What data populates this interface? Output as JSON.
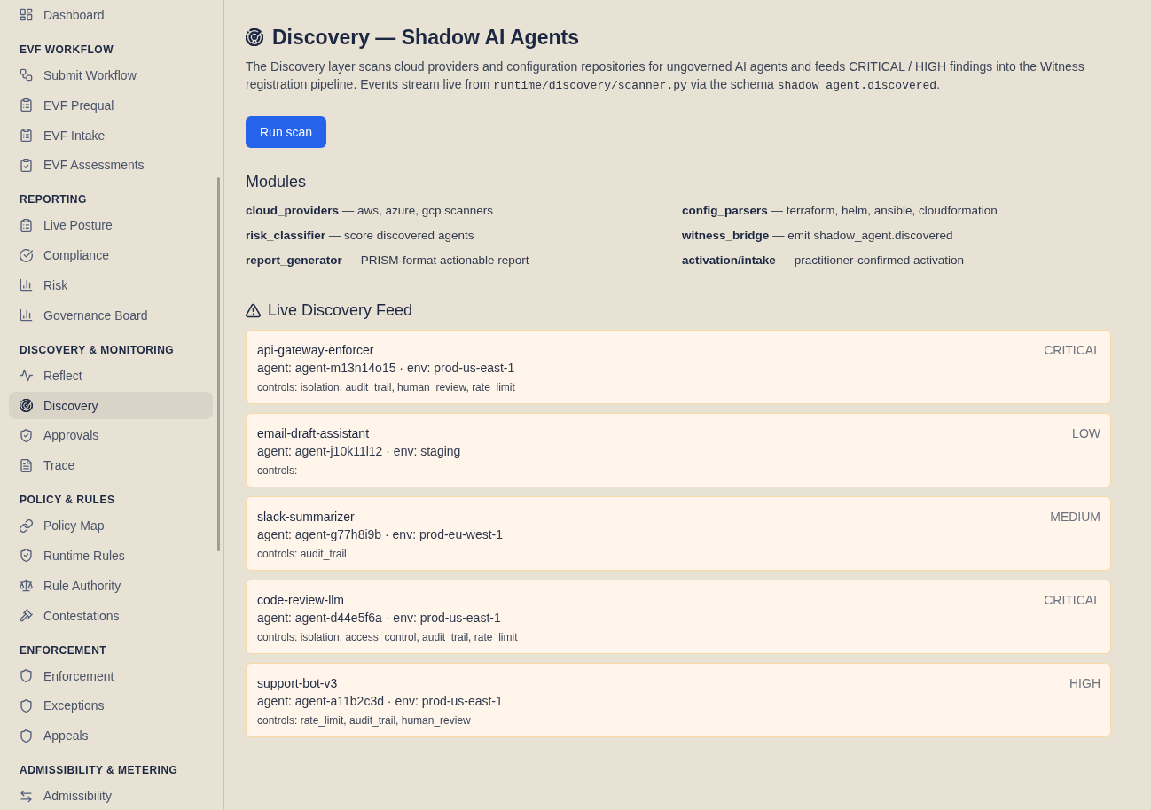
{
  "sidebar": {
    "sections": [
      {
        "items": [
          {
            "label": "Dashboard",
            "selected": false
          }
        ]
      },
      {
        "heading": "EVF WORKFLOW",
        "items": [
          {
            "label": "Submit Workflow",
            "selected": false
          },
          {
            "label": "EVF Prequal",
            "selected": false
          },
          {
            "label": "EVF Intake",
            "selected": false
          },
          {
            "label": "EVF Assessments",
            "selected": false
          }
        ]
      },
      {
        "heading": "REPORTING",
        "items": [
          {
            "label": "Live Posture",
            "selected": false
          },
          {
            "label": "Compliance",
            "selected": false
          },
          {
            "label": "Risk",
            "selected": false
          },
          {
            "label": "Governance Board",
            "selected": false
          }
        ]
      },
      {
        "heading": "DISCOVERY & MONITORING",
        "items": [
          {
            "label": "Reflect",
            "selected": false
          },
          {
            "label": "Discovery",
            "selected": true
          },
          {
            "label": "Approvals",
            "selected": false
          },
          {
            "label": "Trace",
            "selected": false
          }
        ]
      },
      {
        "heading": "POLICY & RULES",
        "items": [
          {
            "label": "Policy Map",
            "selected": false
          },
          {
            "label": "Runtime Rules",
            "selected": false
          },
          {
            "label": "Rule Authority",
            "selected": false
          },
          {
            "label": "Contestations",
            "selected": false
          }
        ]
      },
      {
        "heading": "ENFORCEMENT",
        "items": [
          {
            "label": "Enforcement",
            "selected": false
          },
          {
            "label": "Exceptions",
            "selected": false
          },
          {
            "label": "Appeals",
            "selected": false
          }
        ]
      },
      {
        "heading": "ADMISSIBILITY & METERING",
        "items": [
          {
            "label": "Admissibility",
            "selected": false
          }
        ]
      }
    ]
  },
  "page": {
    "title": "Discovery — Shadow AI Agents",
    "description": [
      {
        "kind": "text",
        "text": "The Discovery layer scans cloud providers and configuration repositories for ungoverned AI agents and feeds CRITICAL / HIGH findings into the Witness registration pipeline. Events stream live from "
      },
      {
        "kind": "code",
        "text": "runtime/discovery/scanner.py"
      },
      {
        "kind": "text",
        "text": " via the schema "
      },
      {
        "kind": "code",
        "text": "shadow_agent.discovered"
      },
      {
        "kind": "text",
        "text": "."
      }
    ],
    "run_button": "Run scan"
  },
  "modules": {
    "heading": "Modules",
    "items": [
      "**cloud_providers** — aws, azure, gcp scanners",
      "**config_parsers** — terraform, helm, ansible, cloudformation",
      "**risk_classifier** — score discovered agents",
      "**witness_bridge** — emit shadow_agent.discovered",
      "**report_generator** — PRISM-format actionable report",
      "**activation/intake** — practitioner-confirmed activation"
    ]
  },
  "feed": {
    "heading": "Live Discovery Feed",
    "findings": [
      {
        "name": "api-gateway-enforcer",
        "details": "agent: agent-m13n14o15 · env: prod-us-east-1",
        "controls": "controls: isolation, audit_trail, human_review, rate_limit",
        "severity": "CRITICAL"
      },
      {
        "name": "email-draft-assistant",
        "details": "agent: agent-j10k11l12 · env: staging",
        "controls": "controls:",
        "severity": "LOW"
      },
      {
        "name": "slack-summarizer",
        "details": "agent: agent-g77h8i9b · env: prod-eu-west-1",
        "controls": "controls: audit_trail",
        "severity": "MEDIUM"
      },
      {
        "name": "code-review-llm",
        "details": "agent: agent-d44e5f6a · env: prod-us-east-1",
        "controls": "controls: isolation, access_control, audit_trail, rate_limit",
        "severity": "CRITICAL"
      },
      {
        "name": "support-bot-v3",
        "details": "agent: agent-a11b2c3d · env: prod-us-east-1",
        "controls": "controls: rate_limit, audit_trail, human_review",
        "severity": "HIGH"
      }
    ]
  }
}
